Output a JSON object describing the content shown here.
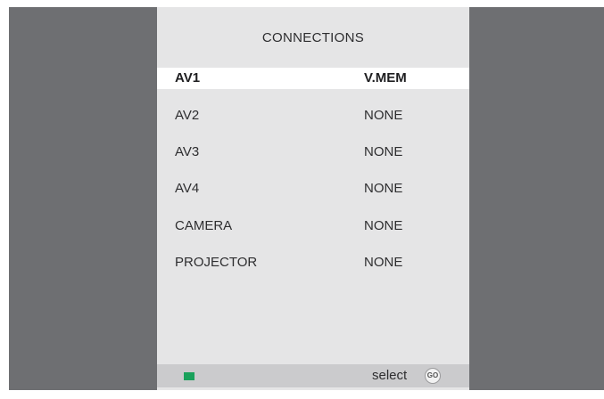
{
  "menu": {
    "title": "CONNECTIONS",
    "items": [
      {
        "label": "AV1",
        "value": "V.MEM"
      },
      {
        "label": "AV2",
        "value": "NONE"
      },
      {
        "label": "AV3",
        "value": "NONE"
      },
      {
        "label": "AV4",
        "value": "NONE"
      },
      {
        "label": "CAMERA",
        "value": "NONE"
      },
      {
        "label": "PROJECTOR",
        "value": "NONE"
      }
    ],
    "selected_index": 0
  },
  "status_bar": {
    "green_key_color": "#1aa15b",
    "select_label": "select",
    "go_icon_text": "GO"
  },
  "colors": {
    "background": "#6e6f72",
    "panel": "#e5e5e6",
    "highlight": "#ffffff"
  }
}
